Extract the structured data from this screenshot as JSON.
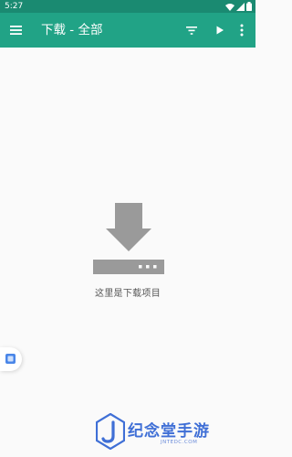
{
  "status_bar": {
    "time": "5:27",
    "icons": [
      "wifi-icon",
      "signal-icon",
      "battery-icon"
    ]
  },
  "app_bar": {
    "title": "下载 - 全部",
    "color": "#21a386",
    "actions": [
      "menu-icon",
      "filter-icon",
      "play-icon",
      "more-vert-icon"
    ]
  },
  "empty_state": {
    "icon": "download-icon",
    "message": "这里是下载项目"
  },
  "watermark": {
    "logo": "jnt-logo",
    "title": "纪念堂手游",
    "subtitle": "JNTEDC.COM"
  }
}
